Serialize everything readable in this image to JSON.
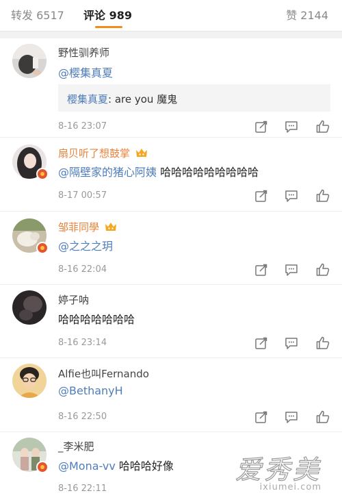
{
  "tabs": {
    "repost": "转发 6517",
    "comment": "评论 989",
    "like": "赞 2144"
  },
  "comments": [
    {
      "name": "野性驯养师",
      "text_mention": "@樱集真夏",
      "text_plain": "",
      "quote_name": "樱集真夏",
      "quote_text": ": are you 魔鬼",
      "time": "8-16 23:07"
    },
    {
      "name": "扇贝听了想鼓掌",
      "text_mention": "@隔壁家的猪心阿姨",
      "text_plain": " 哈哈哈哈哈哈哈哈哈",
      "time": "8-17 00:57"
    },
    {
      "name": "邹菲同學",
      "text_mention": "@之之之玥",
      "text_plain": "",
      "time": "8-16 22:04"
    },
    {
      "name": "婷子呐",
      "text_mention": "",
      "text_plain": "哈哈哈哈哈哈哈",
      "time": "8-16 23:14"
    },
    {
      "name": "Alfie也叫Fernando",
      "text_mention": "@BethanyH",
      "text_plain": "",
      "time": "8-16 22:50"
    },
    {
      "name": "_李米肥",
      "text_mention": "@Mona-vv",
      "text_plain": " 哈哈哈好像",
      "time": "8-16 22:11"
    }
  ],
  "watermark": {
    "cn": "爱秀美",
    "en": "ixiumei.com"
  },
  "colors": {
    "accent": "#f28a1a",
    "mention": "#4f7db9",
    "vip_name": "#e9823b"
  }
}
